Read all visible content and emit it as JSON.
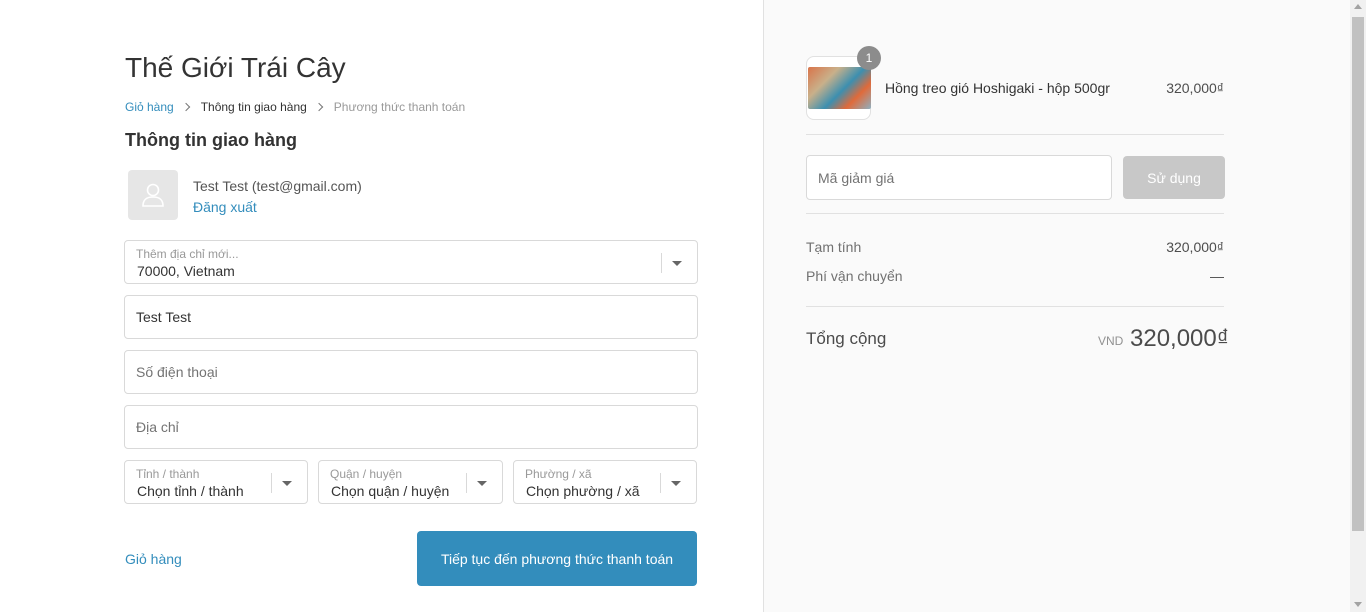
{
  "header": {
    "shop_title": "Thế Giới Trái Cây"
  },
  "breadcrumb": {
    "cart": "Giỏ hàng",
    "shipping_info": "Thông tin giao hàng",
    "payment_method": "Phương thức thanh toán"
  },
  "section": {
    "title": "Thông tin giao hàng"
  },
  "user": {
    "info": "Test Test (test@gmail.com)",
    "logout": "Đăng xuất"
  },
  "form": {
    "address_select": {
      "label": "Thêm địa chỉ mới...",
      "value": "70000, Vietnam"
    },
    "full_name": {
      "value": "Test Test"
    },
    "phone": {
      "placeholder": "Số điện thoại"
    },
    "address": {
      "placeholder": "Địa chỉ"
    },
    "province": {
      "label": "Tỉnh / thành",
      "value": "Chọn tỉnh / thành"
    },
    "district": {
      "label": "Quận / huyện",
      "value": "Chọn quận / huyện"
    },
    "ward": {
      "label": "Phường / xã",
      "value": "Chọn phường / xã"
    }
  },
  "actions": {
    "back_to_cart": "Giỏ hàng",
    "continue": "Tiếp tục đến phương thức thanh toán"
  },
  "order": {
    "items": [
      {
        "name": "Hồng treo gió Hoshigaki - hộp 500gr",
        "quantity": "1",
        "price": "320,000₫"
      }
    ],
    "discount": {
      "placeholder": "Mã giảm giá",
      "apply_label": "Sử dụng"
    },
    "subtotal": {
      "label": "Tạm tính",
      "value": "320,000₫"
    },
    "shipping": {
      "label": "Phí vận chuyển",
      "value": "—"
    },
    "total": {
      "label": "Tổng cộng",
      "currency": "VND",
      "value": "320,000₫"
    }
  },
  "colors": {
    "accent": "#338dbc",
    "sidebar_bg": "#fafafa",
    "disabled_button": "#c8c8c8"
  }
}
